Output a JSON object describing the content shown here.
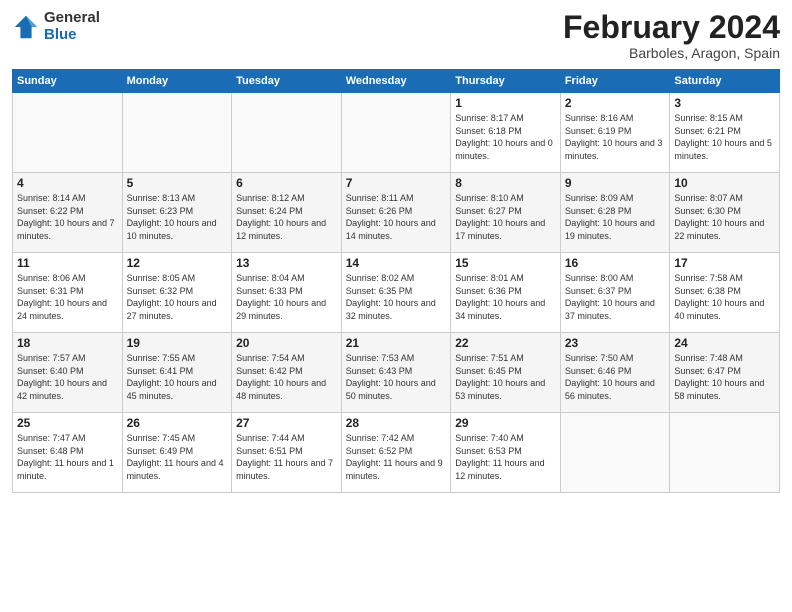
{
  "logo": {
    "general": "General",
    "blue": "Blue"
  },
  "title": "February 2024",
  "location": "Barboles, Aragon, Spain",
  "days_of_week": [
    "Sunday",
    "Monday",
    "Tuesday",
    "Wednesday",
    "Thursday",
    "Friday",
    "Saturday"
  ],
  "weeks": [
    [
      {
        "num": "",
        "info": ""
      },
      {
        "num": "",
        "info": ""
      },
      {
        "num": "",
        "info": ""
      },
      {
        "num": "",
        "info": ""
      },
      {
        "num": "1",
        "info": "Sunrise: 8:17 AM\nSunset: 6:18 PM\nDaylight: 10 hours\nand 0 minutes."
      },
      {
        "num": "2",
        "info": "Sunrise: 8:16 AM\nSunset: 6:19 PM\nDaylight: 10 hours\nand 3 minutes."
      },
      {
        "num": "3",
        "info": "Sunrise: 8:15 AM\nSunset: 6:21 PM\nDaylight: 10 hours\nand 5 minutes."
      }
    ],
    [
      {
        "num": "4",
        "info": "Sunrise: 8:14 AM\nSunset: 6:22 PM\nDaylight: 10 hours\nand 7 minutes."
      },
      {
        "num": "5",
        "info": "Sunrise: 8:13 AM\nSunset: 6:23 PM\nDaylight: 10 hours\nand 10 minutes."
      },
      {
        "num": "6",
        "info": "Sunrise: 8:12 AM\nSunset: 6:24 PM\nDaylight: 10 hours\nand 12 minutes."
      },
      {
        "num": "7",
        "info": "Sunrise: 8:11 AM\nSunset: 6:26 PM\nDaylight: 10 hours\nand 14 minutes."
      },
      {
        "num": "8",
        "info": "Sunrise: 8:10 AM\nSunset: 6:27 PM\nDaylight: 10 hours\nand 17 minutes."
      },
      {
        "num": "9",
        "info": "Sunrise: 8:09 AM\nSunset: 6:28 PM\nDaylight: 10 hours\nand 19 minutes."
      },
      {
        "num": "10",
        "info": "Sunrise: 8:07 AM\nSunset: 6:30 PM\nDaylight: 10 hours\nand 22 minutes."
      }
    ],
    [
      {
        "num": "11",
        "info": "Sunrise: 8:06 AM\nSunset: 6:31 PM\nDaylight: 10 hours\nand 24 minutes."
      },
      {
        "num": "12",
        "info": "Sunrise: 8:05 AM\nSunset: 6:32 PM\nDaylight: 10 hours\nand 27 minutes."
      },
      {
        "num": "13",
        "info": "Sunrise: 8:04 AM\nSunset: 6:33 PM\nDaylight: 10 hours\nand 29 minutes."
      },
      {
        "num": "14",
        "info": "Sunrise: 8:02 AM\nSunset: 6:35 PM\nDaylight: 10 hours\nand 32 minutes."
      },
      {
        "num": "15",
        "info": "Sunrise: 8:01 AM\nSunset: 6:36 PM\nDaylight: 10 hours\nand 34 minutes."
      },
      {
        "num": "16",
        "info": "Sunrise: 8:00 AM\nSunset: 6:37 PM\nDaylight: 10 hours\nand 37 minutes."
      },
      {
        "num": "17",
        "info": "Sunrise: 7:58 AM\nSunset: 6:38 PM\nDaylight: 10 hours\nand 40 minutes."
      }
    ],
    [
      {
        "num": "18",
        "info": "Sunrise: 7:57 AM\nSunset: 6:40 PM\nDaylight: 10 hours\nand 42 minutes."
      },
      {
        "num": "19",
        "info": "Sunrise: 7:55 AM\nSunset: 6:41 PM\nDaylight: 10 hours\nand 45 minutes."
      },
      {
        "num": "20",
        "info": "Sunrise: 7:54 AM\nSunset: 6:42 PM\nDaylight: 10 hours\nand 48 minutes."
      },
      {
        "num": "21",
        "info": "Sunrise: 7:53 AM\nSunset: 6:43 PM\nDaylight: 10 hours\nand 50 minutes."
      },
      {
        "num": "22",
        "info": "Sunrise: 7:51 AM\nSunset: 6:45 PM\nDaylight: 10 hours\nand 53 minutes."
      },
      {
        "num": "23",
        "info": "Sunrise: 7:50 AM\nSunset: 6:46 PM\nDaylight: 10 hours\nand 56 minutes."
      },
      {
        "num": "24",
        "info": "Sunrise: 7:48 AM\nSunset: 6:47 PM\nDaylight: 10 hours\nand 58 minutes."
      }
    ],
    [
      {
        "num": "25",
        "info": "Sunrise: 7:47 AM\nSunset: 6:48 PM\nDaylight: 11 hours\nand 1 minute."
      },
      {
        "num": "26",
        "info": "Sunrise: 7:45 AM\nSunset: 6:49 PM\nDaylight: 11 hours\nand 4 minutes."
      },
      {
        "num": "27",
        "info": "Sunrise: 7:44 AM\nSunset: 6:51 PM\nDaylight: 11 hours\nand 7 minutes."
      },
      {
        "num": "28",
        "info": "Sunrise: 7:42 AM\nSunset: 6:52 PM\nDaylight: 11 hours\nand 9 minutes."
      },
      {
        "num": "29",
        "info": "Sunrise: 7:40 AM\nSunset: 6:53 PM\nDaylight: 11 hours\nand 12 minutes."
      },
      {
        "num": "",
        "info": ""
      },
      {
        "num": "",
        "info": ""
      }
    ]
  ]
}
